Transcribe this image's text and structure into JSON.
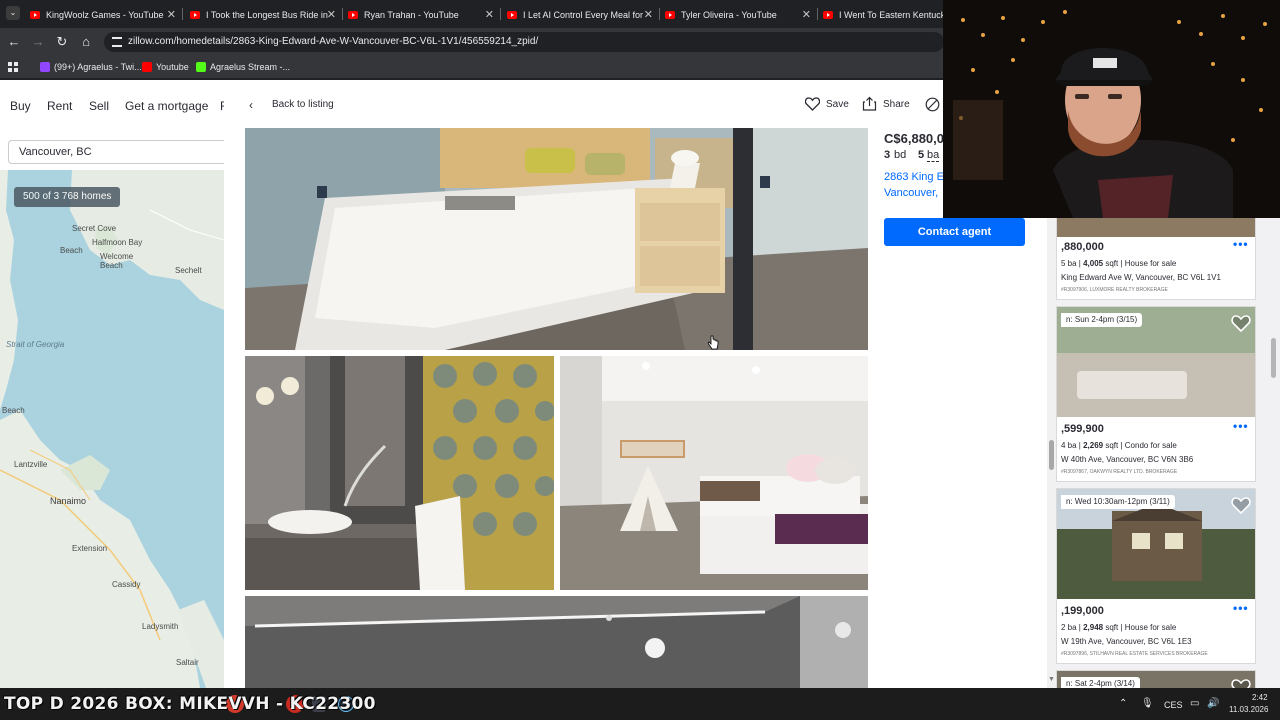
{
  "browser": {
    "tabs": [
      {
        "title": "KingWoolz Games - YouTube"
      },
      {
        "title": "I Took the Longest Bus Ride in"
      },
      {
        "title": "Ryan Trahan - YouTube"
      },
      {
        "title": "I Let AI Control Every Meal for"
      },
      {
        "title": "Tyler Oliveira - YouTube"
      },
      {
        "title": "I Went To Eastern Kentucky (A"
      }
    ],
    "url": "zillow.com/homedetails/2863-King-Edward-Ave-W-Vancouver-BC-V6L-1V1/456559214_zpid/",
    "bookmarks": [
      {
        "label": "(99+) Agraelus - Twi...",
        "color": "#9146ff"
      },
      {
        "label": "Youtube",
        "color": "#ff0000"
      },
      {
        "label": "Agraelus Stream -...",
        "color": "#53fc18"
      }
    ],
    "accent_color": "#006aff"
  },
  "zillow_nav": {
    "items": [
      "Buy",
      "Rent",
      "Sell",
      "Get a mortgage",
      "F"
    ],
    "search_value": "Vancouver, BC",
    "home_count": "500 of 3 768 homes"
  },
  "map": {
    "labels": [
      {
        "text": "Secret Cove"
      },
      {
        "text": "Halfmoon Bay"
      },
      {
        "text": "Beach"
      },
      {
        "text": "Welcome Beach"
      },
      {
        "text": "Sechelt"
      },
      {
        "text": "Strait of Georgia"
      },
      {
        "text": "Beach"
      },
      {
        "text": "Lantzville"
      },
      {
        "text": "Nanaimo"
      },
      {
        "text": "Extension"
      },
      {
        "text": "Cassidy"
      },
      {
        "text": "Ladysmith"
      },
      {
        "text": "Saltair"
      }
    ]
  },
  "modal": {
    "back_label": "Back to listing",
    "save_label": "Save",
    "share_label": "Share",
    "price": "C$6,880,0",
    "beds": "3",
    "beds_unit": "bd",
    "baths": "5",
    "baths_unit": "ba",
    "address_line1": "2863 King E",
    "address_line2": "Vancouver,",
    "contact_label": "Contact agent"
  },
  "listings": [
    {
      "price": ",880,000",
      "facts_prefix": "5 ba | ",
      "sqft": "4,005",
      "facts_suffix": " sqft | House for sale",
      "address": "King Edward Ave W, Vancouver, BC V6L 1V1",
      "broker": "#R3097906, LUXMORE REALTY BROKERAGE",
      "badge": ""
    },
    {
      "price": ",599,900",
      "facts_prefix": "4 ba | ",
      "sqft": "2,269",
      "facts_suffix": " sqft | Condo for sale",
      "address": "W 40th Ave, Vancouver, BC V6N 3B6",
      "broker": "#R3097867, OAKWYN REALTY LTD. BROKERAGE",
      "badge": "n: Sun 2-4pm (3/15)"
    },
    {
      "price": ",199,000",
      "facts_prefix": "2 ba | ",
      "sqft": "2,948",
      "facts_suffix": " sqft | House for sale",
      "address": "W 19th Ave, Vancouver, BC V6L 1E3",
      "broker": "#R3097896, STILHAVN REAL ESTATE SERVICES BROKERAGE",
      "badge": "n: Wed 10:30am-12pm (3/11)"
    },
    {
      "price": "",
      "facts_prefix": "",
      "sqft": "",
      "facts_suffix": "",
      "address": "",
      "broker": "",
      "badge": "n: Sat 2-4pm (3/14)"
    }
  ],
  "overlay": {
    "ticker": "TOP D 2026 BOX: MIKEVVH - KC22300"
  },
  "taskbar": {
    "lang": "CES",
    "time": "2:42",
    "date": "11.03.2026"
  }
}
